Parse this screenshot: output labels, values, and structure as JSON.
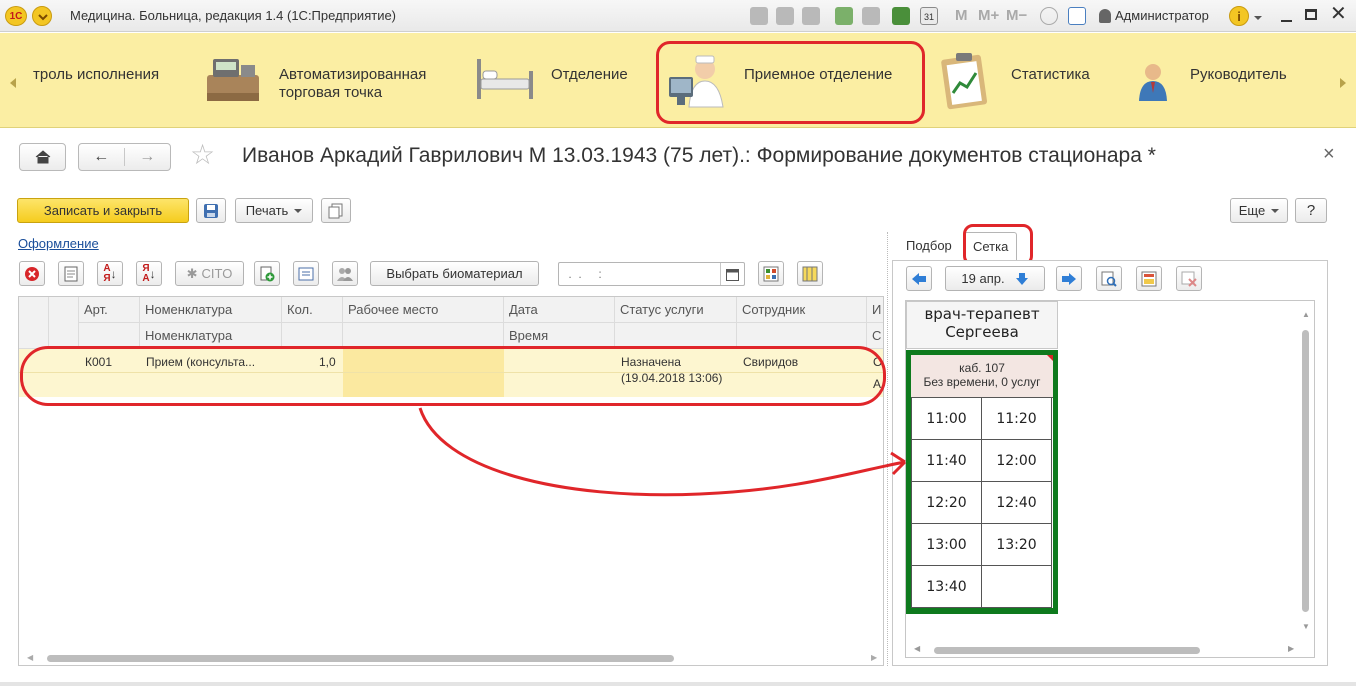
{
  "window": {
    "title": "Медицина. Больница, редакция 1.4 (1С:Предприятие)",
    "user": "Администратор",
    "mem_labels": [
      "M",
      "M+",
      "M−"
    ]
  },
  "sections": {
    "items": [
      {
        "label": "троль исполнения",
        "icon": "checklist-icon"
      },
      {
        "label": "Автоматизированная торговая точка",
        "icon": "cash-register-icon"
      },
      {
        "label": "Отделение",
        "icon": "hospital-bed-icon"
      },
      {
        "label": "Приемное отделение",
        "icon": "doctor-computer-icon",
        "highlighted": true
      },
      {
        "label": "Статистика",
        "icon": "clipboard-chart-icon"
      },
      {
        "label": "Руководитель",
        "icon": "manager-person-icon"
      }
    ],
    "accent": "#fbeea3"
  },
  "form": {
    "title": "Иванов Аркадий Гаврилович М 13.03.1943 (75 лет).: Формирование документов стационара *",
    "close_symbol": "×"
  },
  "toolbar": {
    "save_close": "Записать и закрыть",
    "print": "Печать",
    "more": "Еще",
    "help": "?"
  },
  "link_design": "Оформление",
  "grid_toolbar": {
    "cito": "CITO",
    "select_biomaterial": "Выбрать биоматериал",
    "date_placeholder": " .  .     :"
  },
  "table": {
    "headers_top": [
      "Арт.",
      "Номенклатура",
      "Кол.",
      "Рабочее место",
      "Дата",
      "Статус услуги",
      "Сотрудник",
      "И"
    ],
    "headers_bottom": [
      "",
      "Номенклатура",
      "",
      "",
      "Время",
      "",
      "",
      "С"
    ],
    "rows": [
      {
        "art": "К001",
        "nomenclature": "Прием (консульта...",
        "qty": "1,0",
        "workplace": "",
        "date": "",
        "status": "Назначена",
        "status_time": "(19.04.2018 13:06)",
        "employee": "Свиридов",
        "extra_top": "О",
        "extra_bottom": "А"
      }
    ]
  },
  "right_panel": {
    "tabs": [
      "Подбор",
      "Сетка"
    ],
    "active_tab": "Сетка",
    "date": "19 апр.",
    "doctor_role": "врач-терапевт",
    "doctor_name": "Сергеева",
    "cabinet": "каб. 107",
    "no_time": "Без времени, 0 услуг",
    "slots": [
      "11:00",
      "11:20",
      "11:40",
      "12:00",
      "12:20",
      "12:40",
      "13:00",
      "13:20",
      "13:40",
      ""
    ]
  },
  "colors": {
    "highlight_red": "#e0262a",
    "grid_border_green": "#0e7a1d",
    "save_button_yellow": "#f5cc1e"
  }
}
